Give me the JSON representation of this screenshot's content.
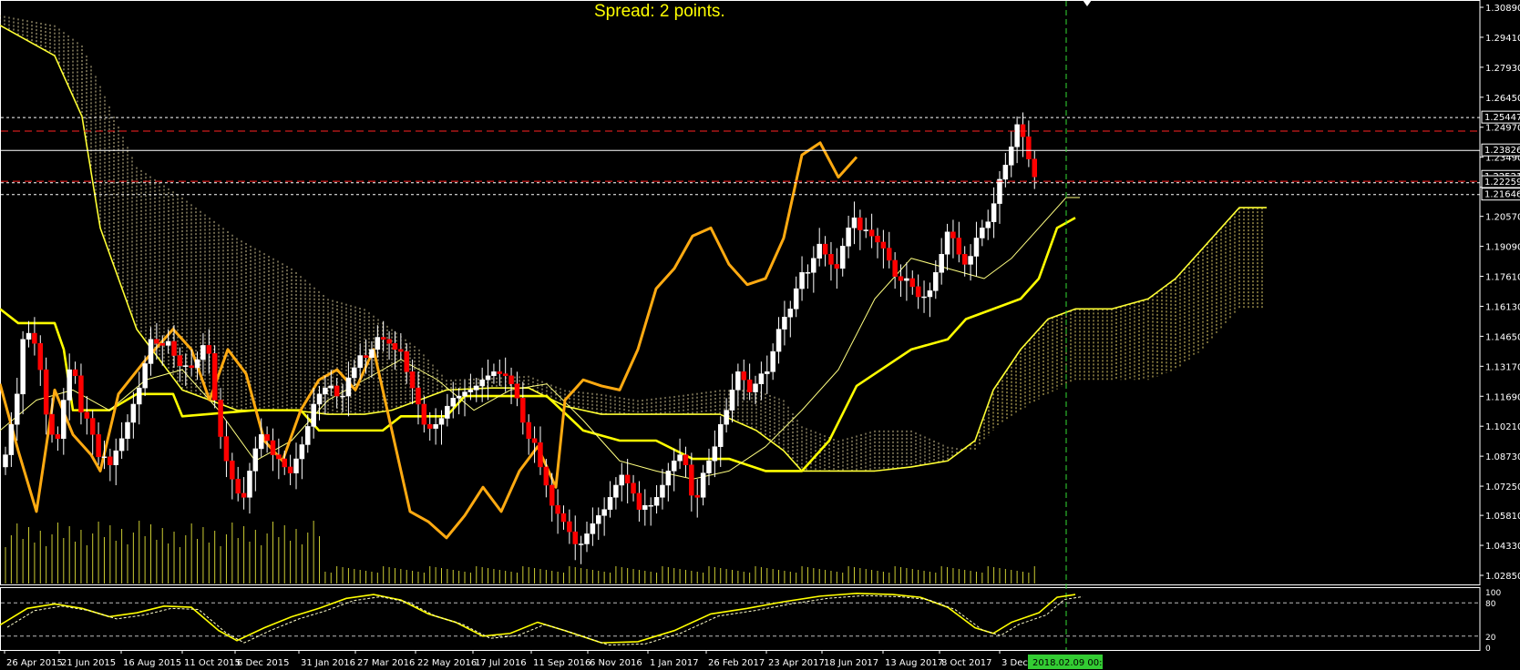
{
  "header": {
    "spread": "Spread: 2 points."
  },
  "chart_data": {
    "type": "candlestick",
    "price_axis": {
      "labels": [
        "1.30890",
        "1.29410",
        "1.27930",
        "1.26450",
        "1.24970",
        "1.23490",
        "1.22010",
        "1.20570",
        "1.19090",
        "1.17610",
        "1.16130",
        "1.14650",
        "1.13170",
        "1.11690",
        "1.10210",
        "1.08730",
        "1.07250",
        "1.05810",
        "1.04330",
        "1.02850"
      ],
      "range": [
        1.0285,
        1.3089
      ],
      "marked_prices": [
        "1.25447",
        "1.23826",
        "1.22521",
        "1.22259",
        "1.21646"
      ]
    },
    "time_axis": {
      "labels": [
        "26 Apr 2015",
        "21 Jun 2015",
        "16 Aug 2015",
        "11 Oct 2015",
        "6 Dec 2015",
        "31 Jan 2016",
        "27 Mar 2016",
        "22 May 2016",
        "17 Jul 2016",
        "11 Sep 2016",
        "6 Nov 2016",
        "1 Jan 2017",
        "26 Feb 2017",
        "23 Apr 2017",
        "18 Jun 2017",
        "13 Aug 2017",
        "8 Oct 2017",
        "3 Dec 2"
      ],
      "cursor_label": "2018.02.09 00:00"
    },
    "horizontal_levels": {
      "red_dashed": [
        1.2478,
        1.223
      ],
      "white_dotted": [
        1.25447,
        1.2223,
        1.21646
      ],
      "white_solid": 1.23826
    },
    "candles": {
      "start_index": 0,
      "closes": [
        1.088,
        1.103,
        1.118,
        1.145,
        1.148,
        1.143,
        1.13,
        1.108,
        1.098,
        1.096,
        1.115,
        1.13,
        1.127,
        1.109,
        1.106,
        1.098,
        1.087,
        1.087,
        1.083,
        1.09,
        1.096,
        1.104,
        1.113,
        1.121,
        1.133,
        1.145,
        1.143,
        1.142,
        1.144,
        1.137,
        1.132,
        1.132,
        1.131,
        1.135,
        1.142,
        1.138,
        1.115,
        1.097,
        1.085,
        1.076,
        1.069,
        1.067,
        1.08,
        1.091,
        1.098,
        1.095,
        1.088,
        1.086,
        1.082,
        1.079,
        1.086,
        1.093,
        1.102,
        1.113,
        1.118,
        1.121,
        1.122,
        1.117,
        1.117,
        1.126,
        1.131,
        1.137,
        1.136,
        1.14,
        1.146,
        1.145,
        1.143,
        1.14,
        1.139,
        1.129,
        1.121,
        1.113,
        1.103,
        1.101,
        1.103,
        1.106,
        1.112,
        1.116,
        1.117,
        1.119,
        1.12,
        1.122,
        1.125,
        1.127,
        1.129,
        1.128,
        1.127,
        1.123,
        1.116,
        1.104,
        1.096,
        1.094,
        1.082,
        1.073,
        1.063,
        1.059,
        1.055,
        1.05,
        1.044,
        1.044,
        1.049,
        1.054,
        1.058,
        1.061,
        1.067,
        1.073,
        1.078,
        1.074,
        1.069,
        1.061,
        1.063,
        1.063,
        1.067,
        1.073,
        1.08,
        1.085,
        1.088,
        1.083,
        1.068,
        1.067,
        1.079,
        1.085,
        1.092,
        1.103,
        1.11,
        1.12,
        1.129,
        1.125,
        1.119,
        1.123,
        1.128,
        1.129,
        1.139,
        1.15,
        1.156,
        1.16,
        1.17,
        1.178,
        1.178,
        1.185,
        1.192,
        1.187,
        1.182,
        1.18,
        1.191,
        1.2,
        1.205,
        1.199,
        1.199,
        1.196,
        1.193,
        1.19,
        1.184,
        1.176,
        1.174,
        1.175,
        1.171,
        1.166,
        1.166,
        1.169,
        1.178,
        1.187,
        1.198,
        1.195,
        1.187,
        1.182,
        1.186,
        1.195,
        1.2,
        1.203,
        1.212,
        1.224,
        1.231,
        1.24,
        1.251,
        1.245,
        1.234,
        1.2252
      ]
    },
    "indicator": {
      "name": "",
      "range": [
        0,
        100
      ],
      "labels": [
        "100",
        "80",
        "20",
        "0"
      ]
    }
  }
}
